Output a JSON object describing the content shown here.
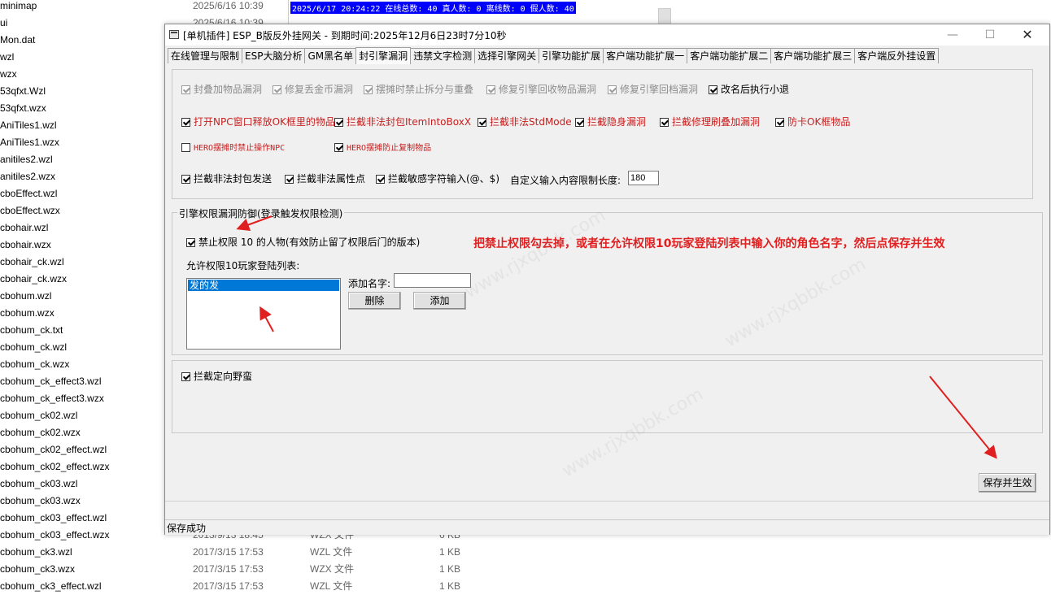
{
  "background_files": [
    {
      "name": "minimap",
      "date": "2025/6/16 10:39",
      "type": "",
      "size": ""
    },
    {
      "name": "ui",
      "date": "2025/6/16 10:39",
      "type": "",
      "size": ""
    },
    {
      "name": "Mon.dat",
      "date": "",
      "type": "",
      "size": ""
    },
    {
      "name": "wzl",
      "date": "",
      "type": "",
      "size": ""
    },
    {
      "name": "wzx",
      "date": "",
      "type": "",
      "size": ""
    },
    {
      "name": "53qfxt.Wzl",
      "date": "",
      "type": "",
      "size": ""
    },
    {
      "name": "53qfxt.wzx",
      "date": "",
      "type": "",
      "size": ""
    },
    {
      "name": "AniTiles1.wzl",
      "date": "",
      "type": "",
      "size": ""
    },
    {
      "name": "AniTiles1.wzx",
      "date": "",
      "type": "",
      "size": ""
    },
    {
      "name": "anitiles2.wzl",
      "date": "",
      "type": "",
      "size": ""
    },
    {
      "name": "anitiles2.wzx",
      "date": "",
      "type": "",
      "size": ""
    },
    {
      "name": "cboEffect.wzl",
      "date": "",
      "type": "",
      "size": ""
    },
    {
      "name": "cboEffect.wzx",
      "date": "",
      "type": "",
      "size": ""
    },
    {
      "name": "cbohair.wzl",
      "date": "",
      "type": "",
      "size": ""
    },
    {
      "name": "cbohair.wzx",
      "date": "",
      "type": "",
      "size": ""
    },
    {
      "name": "cbohair_ck.wzl",
      "date": "",
      "type": "",
      "size": ""
    },
    {
      "name": "cbohair_ck.wzx",
      "date": "",
      "type": "",
      "size": ""
    },
    {
      "name": "cbohum.wzl",
      "date": "",
      "type": "",
      "size": ""
    },
    {
      "name": "cbohum.wzx",
      "date": "",
      "type": "",
      "size": ""
    },
    {
      "name": "cbohum_ck.txt",
      "date": "",
      "type": "",
      "size": ""
    },
    {
      "name": "cbohum_ck.wzl",
      "date": "",
      "type": "",
      "size": ""
    },
    {
      "name": "cbohum_ck.wzx",
      "date": "",
      "type": "",
      "size": ""
    },
    {
      "name": "cbohum_ck_effect3.wzl",
      "date": "",
      "type": "",
      "size": ""
    },
    {
      "name": "cbohum_ck_effect3.wzx",
      "date": "",
      "type": "",
      "size": ""
    },
    {
      "name": "cbohum_ck02.wzl",
      "date": "",
      "type": "",
      "size": ""
    },
    {
      "name": "cbohum_ck02.wzx",
      "date": "",
      "type": "",
      "size": ""
    },
    {
      "name": "cbohum_ck02_effect.wzl",
      "date": "",
      "type": "",
      "size": ""
    },
    {
      "name": "cbohum_ck02_effect.wzx",
      "date": "",
      "type": "",
      "size": ""
    },
    {
      "name": "cbohum_ck03.wzl",
      "date": "",
      "type": "",
      "size": ""
    },
    {
      "name": "cbohum_ck03.wzx",
      "date": "",
      "type": "",
      "size": ""
    },
    {
      "name": "cbohum_ck03_effect.wzl",
      "date": "",
      "type": "",
      "size": ""
    },
    {
      "name": "cbohum_ck03_effect.wzx",
      "date": "2013/9/13 18:45",
      "type": "WZX 文件",
      "size": "6 KB"
    },
    {
      "name": "cbohum_ck3.wzl",
      "date": "2017/3/15 17:53",
      "type": "WZL 文件",
      "size": "1 KB"
    },
    {
      "name": "cbohum_ck3.wzx",
      "date": "2017/3/15 17:53",
      "type": "WZX 文件",
      "size": "1 KB"
    },
    {
      "name": "cbohum_ck3_effect.wzl",
      "date": "2017/3/15 17:53",
      "type": "WZL 文件",
      "size": "1 KB"
    }
  ],
  "log_line": "2025/6/17 20:24:22 在线总数: 40 真人数: 0 离线数: 0 假人数: 40",
  "window": {
    "title": "[单机插件] ESP_B版反外挂网关 - 到期时间:2025年12月6日23时7分10秒",
    "minimize": "—",
    "maximize": "☐",
    "close": "✕"
  },
  "tabs": [
    {
      "label": "在线管理与限制",
      "active": false
    },
    {
      "label": "ESP大脑分析",
      "active": false
    },
    {
      "label": "GM黑名单",
      "active": false
    },
    {
      "label": "封引擎漏洞",
      "active": true
    },
    {
      "label": "违禁文字检测",
      "active": false
    },
    {
      "label": "选择引擎网关",
      "active": false
    },
    {
      "label": "引擎功能扩展",
      "active": false
    },
    {
      "label": "客户端功能扩展一",
      "active": false
    },
    {
      "label": "客户端功能扩展二",
      "active": false
    },
    {
      "label": "客户端功能扩展三",
      "active": false
    },
    {
      "label": "客户端反外挂设置",
      "active": false
    }
  ],
  "options_row1": [
    {
      "label": "封叠加物品漏洞",
      "checked": true,
      "disabled": true
    },
    {
      "label": "修复丢金币漏洞",
      "checked": true,
      "disabled": true
    },
    {
      "label": "摆摊时禁止拆分与重叠",
      "checked": true,
      "disabled": true
    },
    {
      "label": "修复引擎回收物品漏洞",
      "checked": true,
      "disabled": true
    },
    {
      "label": "修复引擎回档漏洞",
      "checked": true,
      "disabled": true
    },
    {
      "label": "改名后执行小退",
      "checked": true,
      "disabled": false
    }
  ],
  "options_row2": [
    {
      "label": "打开NPC窗口释放OK框里的物品",
      "checked": true
    },
    {
      "label": "拦截非法封包ItemIntoBoxX",
      "checked": true
    },
    {
      "label": "拦截非法StdMode",
      "checked": true
    },
    {
      "label": "拦截隐身漏洞",
      "checked": true
    },
    {
      "label": "拦截修理刷叠加漏洞",
      "checked": true
    },
    {
      "label": "防卡OK框物品",
      "checked": true
    }
  ],
  "options_row3": [
    {
      "label": "HERO摆摊时禁止操作NPC",
      "checked": false
    },
    {
      "label": "HERO摆摊防止复制物品",
      "checked": true
    }
  ],
  "options_row4": [
    {
      "label": "拦截非法封包发送",
      "checked": true
    },
    {
      "label": "拦截非法属性点",
      "checked": true
    },
    {
      "label": "拦截敏感字符输入(@、$)",
      "checked": true
    }
  ],
  "custom_input_label": "自定义输入内容限制长度:",
  "custom_input_value": "180",
  "permission_group": {
    "title": "引擎权限漏洞防御(登录触发权限检测)",
    "ban_label": "禁止权限 10 的人物(有效防止留了权限后门的版本)",
    "ban_checked": true,
    "allow_list_label": "允许权限10玩家登陆列表:",
    "allow_list": [
      "发的发"
    ],
    "add_name_label": "添加名字:",
    "add_name_value": "",
    "delete_button": "删除",
    "add_button": "添加"
  },
  "annotation": "把禁止权限勾去掉，或者在允许权限10玩家登陆列表中输入你的角色名字，然后点保存并生效",
  "hijack_option": {
    "label": "拦截定向野蛮",
    "checked": true
  },
  "save_button": "保存并生效",
  "status": "保存成功",
  "colors": {
    "accent_red": "#c81e1e",
    "annotation_red": "#e02020",
    "selection_blue": "#0078d7"
  },
  "watermark_text": "www.rjxqbbk.com"
}
